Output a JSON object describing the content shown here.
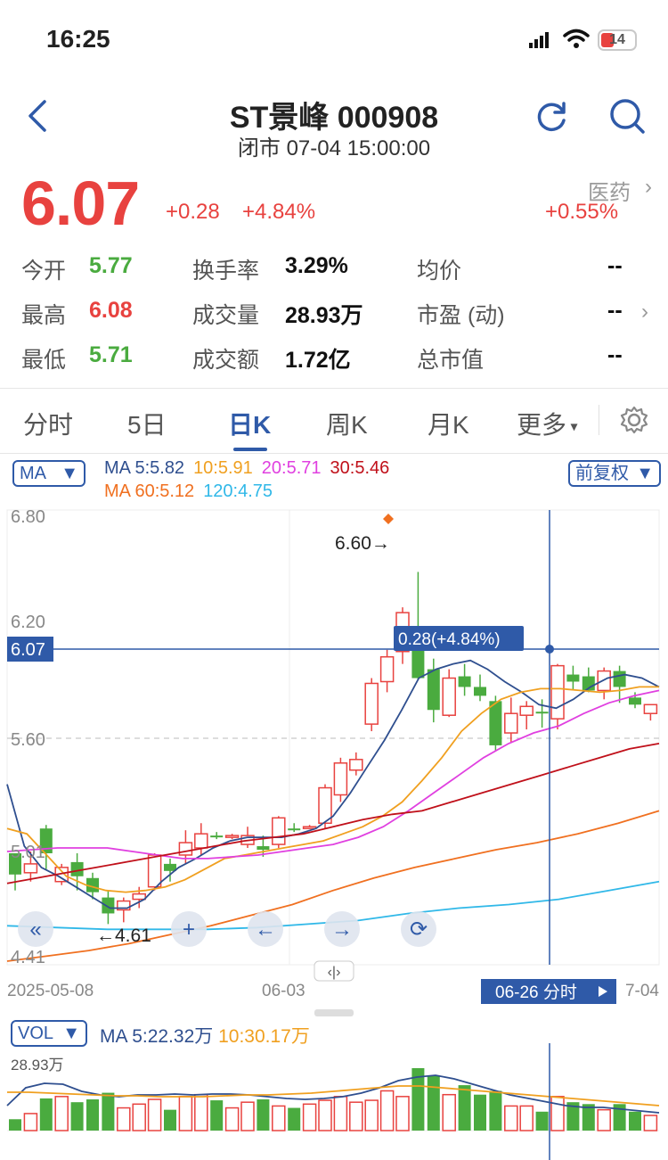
{
  "status": {
    "time": "16:25",
    "battery": "14"
  },
  "header": {
    "title": "ST景峰 000908",
    "subtitle": "闭市 07-04 15:00:00"
  },
  "quote": {
    "price": "6.07",
    "change": "+0.28",
    "change_pct": "+4.84%",
    "sector": "医药",
    "sector_change": "+0.55%"
  },
  "stats": [
    {
      "label": "今开",
      "value": "5.77",
      "color": "green"
    },
    {
      "label": "换手率",
      "value": "3.29%",
      "color": "black"
    },
    {
      "label": "均价",
      "value": "--",
      "color": "black"
    },
    {
      "label": "最高",
      "value": "6.08",
      "color": "red"
    },
    {
      "label": "成交量",
      "value": "28.93万",
      "color": "black"
    },
    {
      "label": "市盈 (动)",
      "value": "--",
      "color": "black"
    },
    {
      "label": "最低",
      "value": "5.71",
      "color": "green"
    },
    {
      "label": "成交额",
      "value": "1.72亿",
      "color": "black"
    },
    {
      "label": "总市值",
      "value": "--",
      "color": "black"
    }
  ],
  "tabs": [
    "分时",
    "5日",
    "日K",
    "周K",
    "月K",
    "更多"
  ],
  "ma": {
    "selector": "MA",
    "line1": [
      {
        "t": "MA 5:5.82",
        "c": "#2f4f8f"
      },
      {
        "t": "10:5.91",
        "c": "#f0a020"
      },
      {
        "t": "20:5.71",
        "c": "#e040e0"
      },
      {
        "t": "30:5.46",
        "c": "#c0101a"
      }
    ],
    "line2": [
      {
        "t": "MA 60:5.12",
        "c": "#f07020"
      },
      {
        "t": "120:4.75",
        "c": "#30b8e8"
      }
    ],
    "adjust": "前复权"
  },
  "chart": {
    "y_labels": {
      "top": "6.80",
      "mid1": "6.20",
      "mid2": "5.60",
      "low": "5.01",
      "bottom": "4.41"
    },
    "crosshair_price": "6.07",
    "tooltip": "0.28(+4.84%)",
    "max_label": "6.60→",
    "min_label": "←4.61",
    "x_labels": [
      "2025-05-08",
      "06-03",
      "7-04"
    ],
    "crosshair_date": "06-26 分时",
    "scroll_handle": "‹|›"
  },
  "vol": {
    "selector": "VOL",
    "ma_prefix": "MA",
    "ma5": "5:22.32万",
    "ma10": "10:30.17万",
    "max": "28.93万"
  },
  "colors": {
    "up": "#e8423f",
    "down": "#4aab3f",
    "accent": "#2f5aa8"
  },
  "chart_data": {
    "type": "candlestick",
    "candles": [
      [
        5.01,
        4.89,
        5.01,
        4.8
      ],
      [
        4.9,
        4.95,
        5.02,
        4.85
      ],
      [
        5.15,
        5.01,
        5.17,
        4.92
      ],
      [
        4.85,
        4.93,
        4.95,
        4.83
      ],
      [
        4.96,
        4.88,
        5.01,
        4.8
      ],
      [
        4.87,
        4.79,
        4.9,
        4.75
      ],
      [
        4.76,
        4.67,
        4.8,
        4.61
      ],
      [
        4.69,
        4.74,
        4.76,
        4.62
      ],
      [
        4.75,
        4.78,
        4.82,
        4.7
      ],
      [
        4.82,
        5.0,
        5.01,
        4.8
      ],
      [
        4.95,
        4.91,
        4.98,
        4.85
      ],
      [
        5.0,
        5.07,
        5.14,
        4.95
      ],
      [
        5.04,
        5.12,
        5.18,
        5.0
      ],
      [
        5.11,
        5.1,
        5.13,
        5.09
      ],
      [
        5.1,
        5.11,
        5.12,
        5.09
      ],
      [
        5.06,
        5.11,
        5.16,
        5.04
      ],
      [
        5.05,
        5.03,
        5.11,
        4.99
      ],
      [
        5.06,
        5.21,
        5.22,
        5.04
      ],
      [
        5.15,
        5.14,
        5.18,
        5.13
      ],
      [
        5.16,
        5.16,
        5.17,
        5.15
      ],
      [
        5.18,
        5.38,
        5.4,
        5.15
      ],
      [
        5.34,
        5.52,
        5.55,
        5.3
      ],
      [
        5.48,
        5.54,
        5.58,
        5.45
      ],
      [
        5.74,
        5.97,
        6.0,
        5.7
      ],
      [
        5.98,
        6.12,
        6.16,
        5.92
      ],
      [
        6.15,
        6.37,
        6.4,
        6.08
      ],
      [
        6.25,
        6.0,
        6.6,
        5.99
      ],
      [
        6.05,
        5.82,
        6.11,
        5.75
      ],
      [
        5.79,
        6.0,
        6.05,
        5.78
      ],
      [
        6.01,
        5.95,
        6.08,
        5.9
      ],
      [
        5.95,
        5.9,
        6.02,
        5.87
      ],
      [
        5.87,
        5.62,
        5.9,
        5.59
      ],
      [
        5.69,
        5.8,
        5.89,
        5.64
      ],
      [
        5.79,
        5.84,
        5.87,
        5.71
      ],
      [
        5.81,
        5.8,
        5.88,
        5.72
      ],
      [
        5.77,
        6.07,
        6.08,
        5.71
      ],
      [
        6.02,
        5.98,
        6.07,
        5.93
      ],
      [
        6.01,
        5.93,
        6.06,
        5.92
      ],
      [
        5.93,
        6.04,
        6.06,
        5.88
      ],
      [
        6.04,
        5.95,
        6.07,
        5.86
      ],
      [
        5.89,
        5.85,
        5.92,
        5.83
      ],
      [
        5.8,
        5.85,
        5.85,
        5.76
      ]
    ],
    "volume_max": "28.93万"
  }
}
